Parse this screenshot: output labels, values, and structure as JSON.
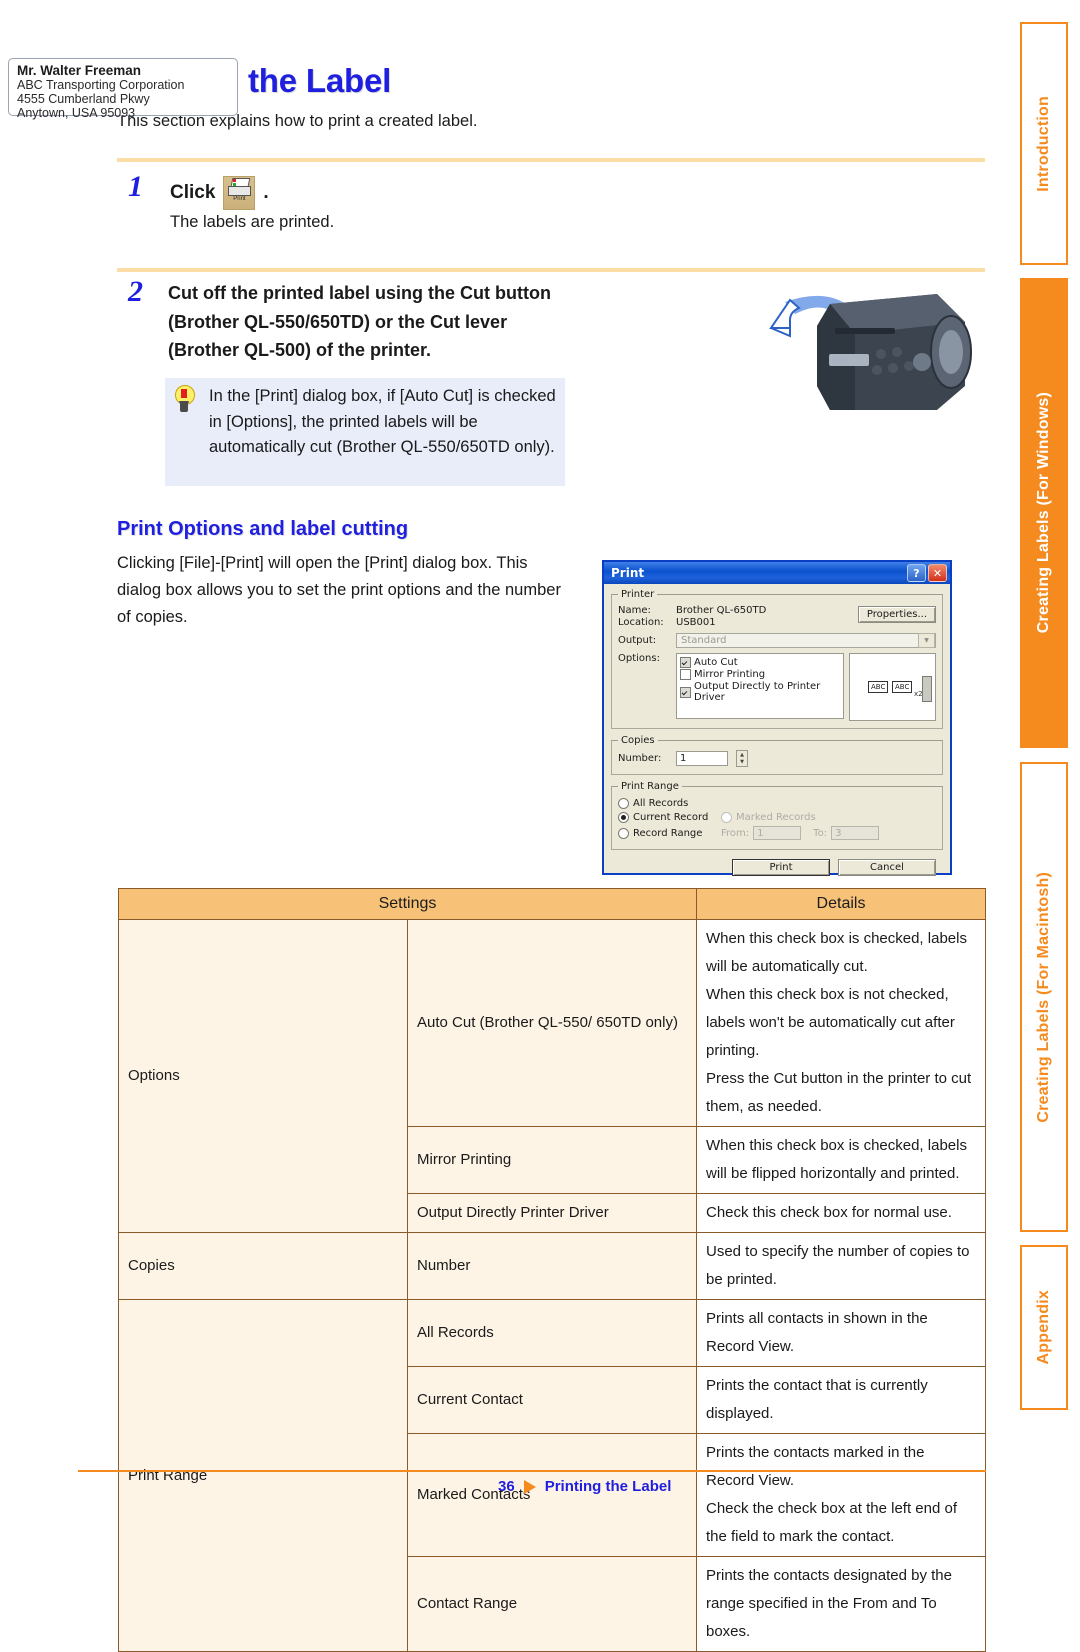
{
  "header": {
    "title": "Printing the Label",
    "intro": "This section explains how to print a created label."
  },
  "steps": [
    {
      "number": "1",
      "click_label": "Click",
      "icon_label": "Print",
      "period": ".",
      "sub": "The labels are printed."
    },
    {
      "number": "2",
      "heading": "Cut off the printed label using the Cut button (Brother QL-550/650TD) or the Cut lever (Brother QL-500) of the printer."
    }
  ],
  "tip": {
    "icon": "lightbulb-icon",
    "text": "In the [Print] dialog box, if [Auto Cut] is checked in [Options], the printed labels will be automatically cut (Brother QL-550/650TD only)."
  },
  "illustration": {
    "label_name": "Mr. Walter Freeman",
    "label_company": "ABC Transporting Corporation",
    "label_street": "4555 Cumberland Pkwy",
    "label_city": "Anytown, USA 95093"
  },
  "section": {
    "heading": "Print Options and label cutting",
    "body": "Clicking [File]-[Print] will open the [Print] dialog box. This dialog box allows you to set the print options and the number of copies."
  },
  "dialog": {
    "title": "Print",
    "help_btn": "?",
    "close_btn": "✕",
    "printer_group": "Printer",
    "name_label": "Name:",
    "name_value": "Brother QL-650TD",
    "location_label": "Location:",
    "location_value": "USB001",
    "properties_btn": "Properties...",
    "output_label": "Output:",
    "output_value": "Standard",
    "options_label": "Options:",
    "options": [
      {
        "label": "Auto Cut",
        "checked": true
      },
      {
        "label": "Mirror Printing",
        "checked": false
      },
      {
        "label": "Output Directly to Printer Driver",
        "checked": true
      }
    ],
    "preview": {
      "a": "ABC",
      "b": "ABC",
      "mult": "x2"
    },
    "copies_group": "Copies",
    "number_label": "Number:",
    "number_value": "1",
    "range_group": "Print Range",
    "range_options": [
      {
        "label": "All Records",
        "selected": false,
        "disabled": false
      },
      {
        "label": "Current Record",
        "selected": true,
        "disabled": false
      },
      {
        "label": "Marked Records",
        "selected": false,
        "disabled": true
      },
      {
        "label": "Record Range",
        "selected": false,
        "disabled": false
      }
    ],
    "from_label": "From:",
    "from_value": "1",
    "to_label": "To:",
    "to_value": "3",
    "print_btn": "Print",
    "cancel_btn": "Cancel"
  },
  "table": {
    "headers": [
      "Settings",
      "Details"
    ],
    "rows": [
      {
        "group": "Options",
        "group_rowspan": 3,
        "setting": "Auto Cut (Brother QL-550/ 650TD only)",
        "details": "When this check box is checked, labels will be automatically cut.\nWhen this check box is not checked, labels won't be automatically cut after printing.\nPress the Cut button in the printer to cut them, as needed."
      },
      {
        "setting": "Mirror Printing",
        "details": "When this check box is checked, labels will be flipped horizontally and printed."
      },
      {
        "setting": "Output Directly Printer Driver",
        "details": "Check this check box for normal use."
      },
      {
        "group": "Copies",
        "group_rowspan": 1,
        "setting": "Number",
        "details": "Used to specify the number of copies to be printed."
      },
      {
        "group": "Print Range",
        "group_rowspan": 4,
        "setting": "All Records",
        "details": "Prints all contacts in shown in the Record View."
      },
      {
        "setting": "Current Contact",
        "details": "Prints the contact that is currently displayed."
      },
      {
        "setting": "Marked Contacts",
        "details": "Prints the contacts marked in the Record View.\nCheck the check box at the left end of the field to mark the contact."
      },
      {
        "setting": "Contact Range",
        "details": "Prints the contacts designated by the range specified in the From and To boxes."
      }
    ]
  },
  "side_tabs": [
    {
      "label": "Introduction",
      "active": false
    },
    {
      "label": "Creating Labels (For Windows)",
      "active": true
    },
    {
      "label": "Creating Labels (For Macintosh)",
      "active": false
    },
    {
      "label": "Appendix",
      "active": false
    }
  ],
  "footer": {
    "page": "36",
    "text": "Printing the Label"
  },
  "colors": {
    "heading_blue": "#1F1FE0",
    "accent_orange": "#F58A1F",
    "table_header": "#F7C277",
    "table_key_cell": "#FDF4E6",
    "tip_bg": "#E8EDF9"
  }
}
